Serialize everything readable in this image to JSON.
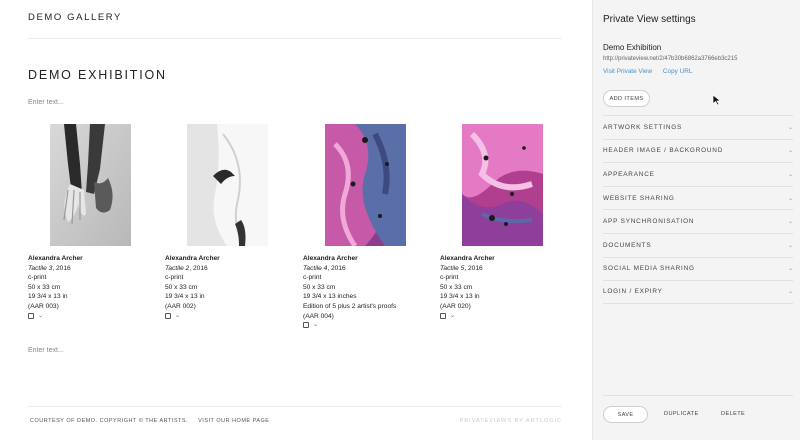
{
  "header": {
    "brand": "DEMO GALLERY"
  },
  "exhibition": {
    "title": "DEMO EXHIBITION",
    "placeholder_top": "Enter text...",
    "placeholder_bottom": "Enter text..."
  },
  "artworks": [
    {
      "artist": "Alexandra Archer",
      "title": "Tactile 3",
      "year": ", 2016",
      "lines": [
        "c-print",
        "50 x 33 cm",
        "19 3/4 x 13 in",
        "(AAR 003)"
      ],
      "image": "hands-photo"
    },
    {
      "artist": "Alexandra Archer",
      "title": "Tactile 2",
      "year": ", 2016",
      "lines": [
        "c-print",
        "50 x 33 cm",
        "19 3/4 x 13 in",
        "(AAR 002)"
      ],
      "image": "white-fabric-photo"
    },
    {
      "artist": "Alexandra Archer",
      "title": "Tactile 4",
      "year": ", 2016",
      "lines": [
        "c-print",
        "50 x 33 cm",
        "19 3/4 x 13 inches",
        "Edition of 5 plus 2 artist's proofs",
        "(AAR 004)"
      ],
      "image": "fluid-pink-blue-photo"
    },
    {
      "artist": "Alexandra Archer",
      "title": "Tactile 5",
      "year": ", 2016",
      "lines": [
        "c-print",
        "50 x 33 cm",
        "19 3/4 x 13 in",
        "(AAR 020)"
      ],
      "image": "fluid-pink-photo"
    }
  ],
  "footer": {
    "courtesy": "COURTESY OF DEMO. COPYRIGHT © THE ARTISTS.",
    "home_link": "VISIT OUR HOME PAGE",
    "powered": "PRIVATEVIEWS BY ARTLOGIC"
  },
  "panel": {
    "title": "Private View settings",
    "exhibition_name": "Demo Exhibition",
    "url": "http://privateview.net/2/47b30b6862a3766eb3c215",
    "visit_link": "Visit Private View",
    "copy_link": "Copy URL",
    "add_items": "ADD ITEMS",
    "sections": [
      "ARTWORK SETTINGS",
      "HEADER IMAGE / BACKGROUND",
      "APPEARANCE",
      "WEBSITE SHARING",
      "APP SYNCHRONISATION",
      "DOCUMENTS",
      "SOCIAL MEDIA SHARING",
      "LOGIN / EXPIRY"
    ],
    "save": "SAVE",
    "duplicate": "DUPLICATE",
    "delete": "DELETE"
  },
  "colors": {
    "link": "#4a90c8",
    "panel_bg": "#f4f4f4"
  }
}
